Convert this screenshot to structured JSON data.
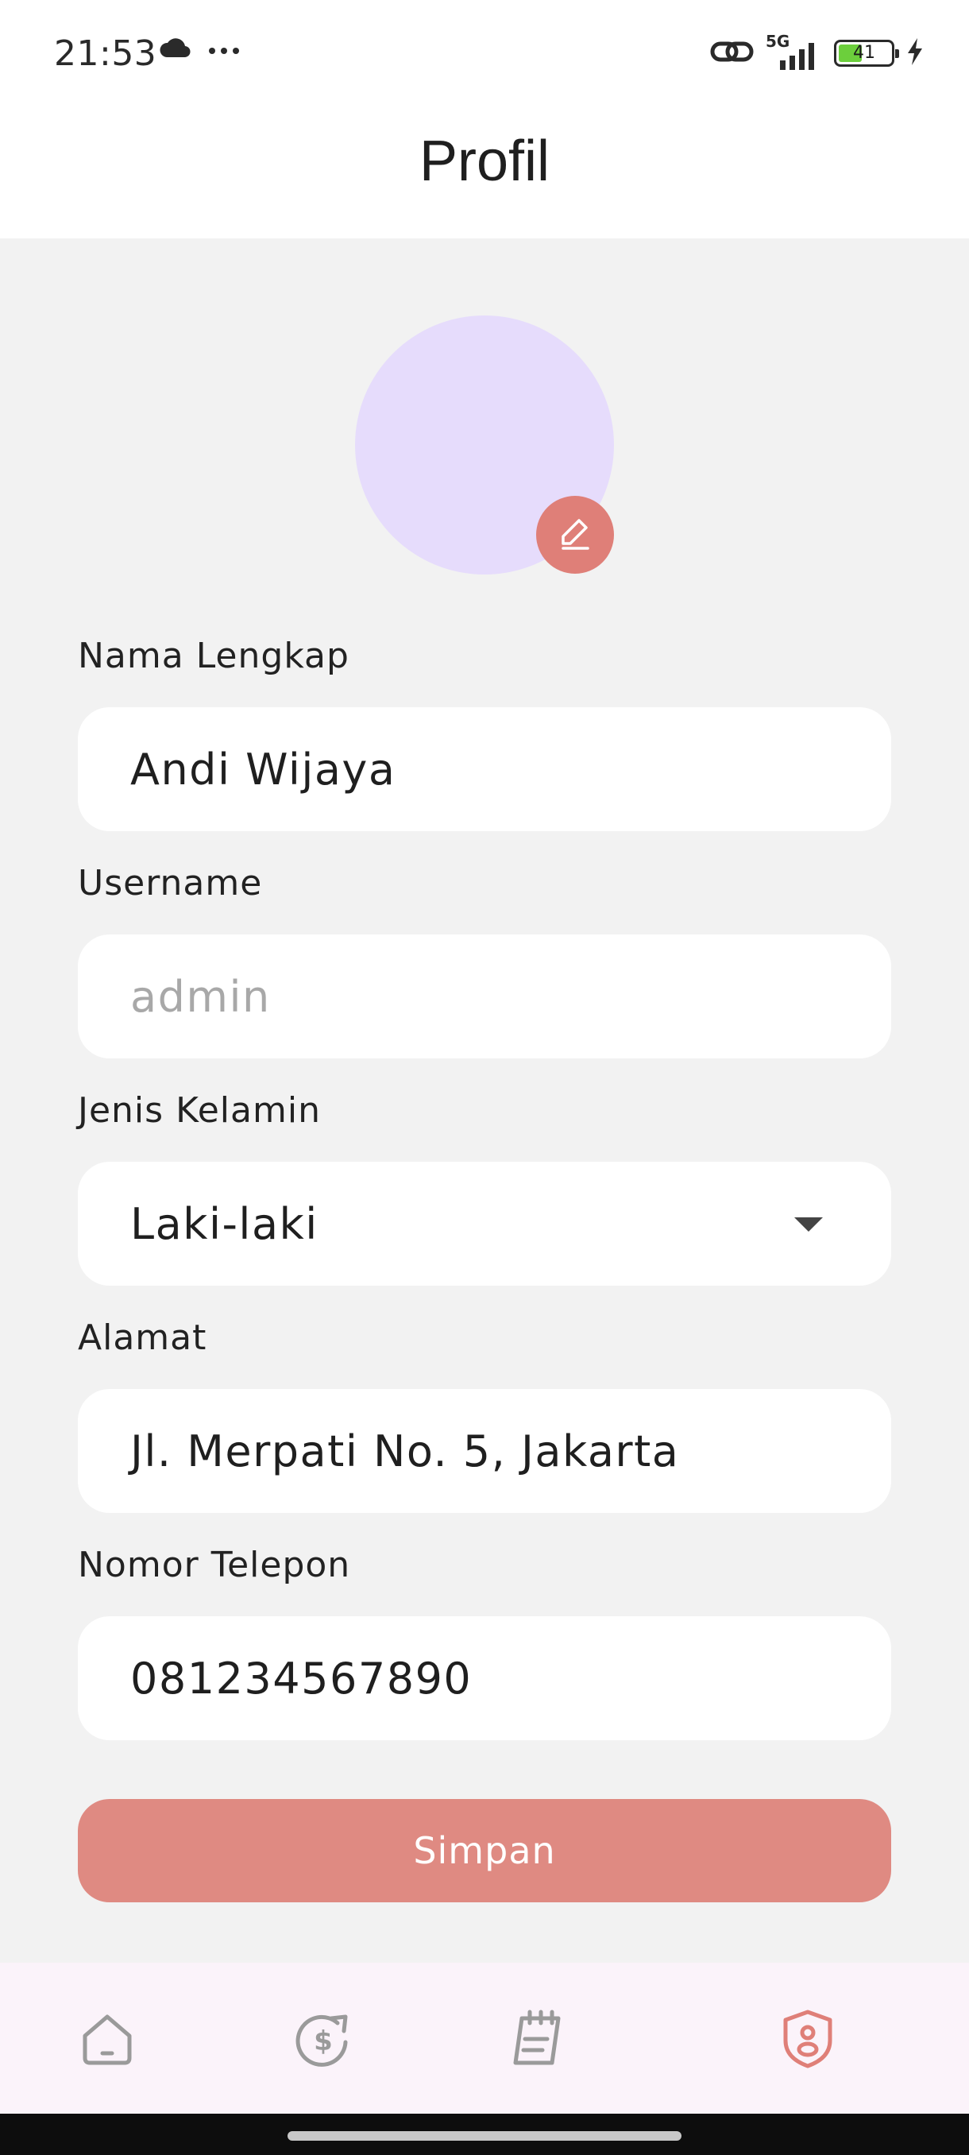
{
  "status_bar": {
    "time": "21:53",
    "network": "5G",
    "battery_level": "41",
    "icons": [
      "cloud-icon",
      "more-dots-icon",
      "link-icon",
      "signal-5g-icon",
      "battery-icon",
      "charging-bolt-icon"
    ]
  },
  "header": {
    "title": "Profil"
  },
  "avatar": {
    "bg_color": "#e6dcfc",
    "edit_icon": "pencil-icon",
    "edit_color": "#df7f78"
  },
  "form": {
    "full_name": {
      "label": "Nama Lengkap",
      "value": "Andi Wijaya"
    },
    "username": {
      "label": "Username",
      "placeholder": "admin"
    },
    "gender": {
      "label": "Jenis Kelamin",
      "selected": "Laki-laki"
    },
    "address": {
      "label": "Alamat",
      "value": "Jl. Merpati No. 5, Jakarta"
    },
    "phone": {
      "label": "Nomor Telepon",
      "value": "081234567890"
    },
    "save_label": "Simpan",
    "save_color": "#df8a82"
  },
  "bottom_nav": {
    "items": [
      {
        "name": "home",
        "icon": "home-icon",
        "active": false
      },
      {
        "name": "finance",
        "icon": "dollar-exchange-icon",
        "active": false
      },
      {
        "name": "notes",
        "icon": "notepad-icon",
        "active": false
      },
      {
        "name": "profile",
        "icon": "profile-badge-icon",
        "active": true
      }
    ],
    "active_color": "#df7f78",
    "inactive_color": "#9a9a9a"
  }
}
